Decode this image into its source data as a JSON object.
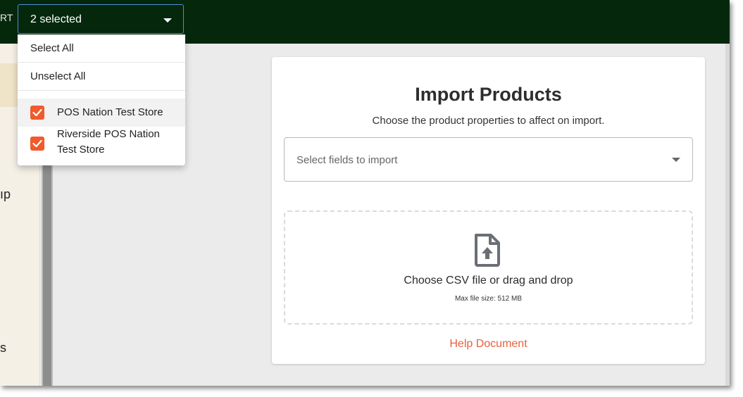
{
  "topbar": {
    "partial_text": "RT"
  },
  "left_panel": {
    "partial_text_1": "ıp",
    "partial_text_2": "s"
  },
  "store_select": {
    "value": "2 selected",
    "menu": {
      "select_all": "Select All",
      "unselect_all": "Unselect All",
      "options": [
        {
          "label": "POS Nation Test Store",
          "checked": true
        },
        {
          "label": "Riverside POS Nation Test Store",
          "checked": true
        }
      ]
    }
  },
  "import_card": {
    "title": "Import Products",
    "subtitle": "Choose the product properties to affect on import.",
    "fields_select": {
      "placeholder": "Select fields to import"
    },
    "dropzone": {
      "icon": "file-upload-icon",
      "label": "Choose CSV file or drag and drop",
      "note": "Max file size: 512 MB"
    },
    "help_link": "Help Document"
  },
  "colors": {
    "topbar_bg": "#05280c",
    "accent_orange": "#f15a2b",
    "link_orange": "#e8603c",
    "page_bg": "#ebebeb"
  }
}
